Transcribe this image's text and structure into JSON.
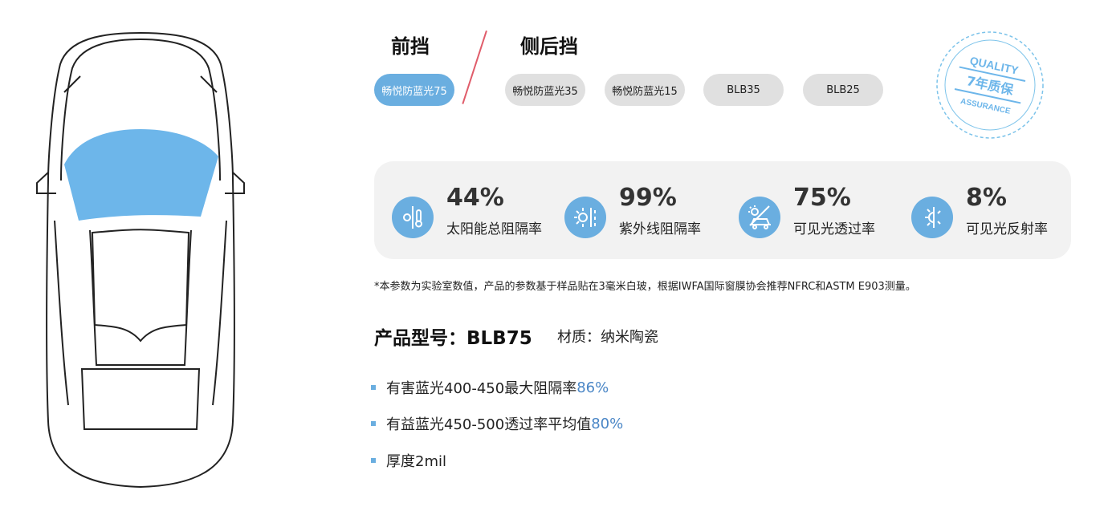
{
  "tabs": {
    "front": "前挡",
    "side_rear": "侧后挡"
  },
  "products": [
    {
      "label": "畅悦防蓝光75",
      "active": true
    },
    {
      "label": "畅悦防蓝光35",
      "active": false
    },
    {
      "label": "畅悦防蓝光15",
      "active": false
    },
    {
      "label": "BLB35",
      "active": false
    },
    {
      "label": "BLB25",
      "active": false
    }
  ],
  "badge": {
    "top": "QUALITY",
    "middle": "7年质保",
    "bottom": "ASSURANCE"
  },
  "stats": [
    {
      "value": "44%",
      "label": "太阳能总阻隔率",
      "icon": "thermometer-sun-icon"
    },
    {
      "value": "99%",
      "label": "紫外线阻隔率",
      "icon": "uv-sun-icon"
    },
    {
      "value": "75%",
      "label": "可见光透过率",
      "icon": "car-sun-icon"
    },
    {
      "value": "8%",
      "label": "可见光反射率",
      "icon": "sun-reflect-icon"
    }
  ],
  "note": "*本参数为实验室数值，产品的参数基于样品贴在3毫米白玻，根据IWFA国际窗膜协会推荐NFRC和ASTM E903测量。",
  "model": "产品型号：BLB75",
  "material": "材质：纳米陶瓷",
  "features": [
    {
      "text": "有害蓝光400-450最大阻隔率",
      "highlight": "86%"
    },
    {
      "text": "有益蓝光450-500透过率平均值",
      "highlight": "80%"
    },
    {
      "text": "厚度2mil",
      "highlight": ""
    }
  ],
  "colors": {
    "accent": "#6aaee0",
    "highlight": "#4a86c6",
    "divider": "#e05c6a"
  }
}
